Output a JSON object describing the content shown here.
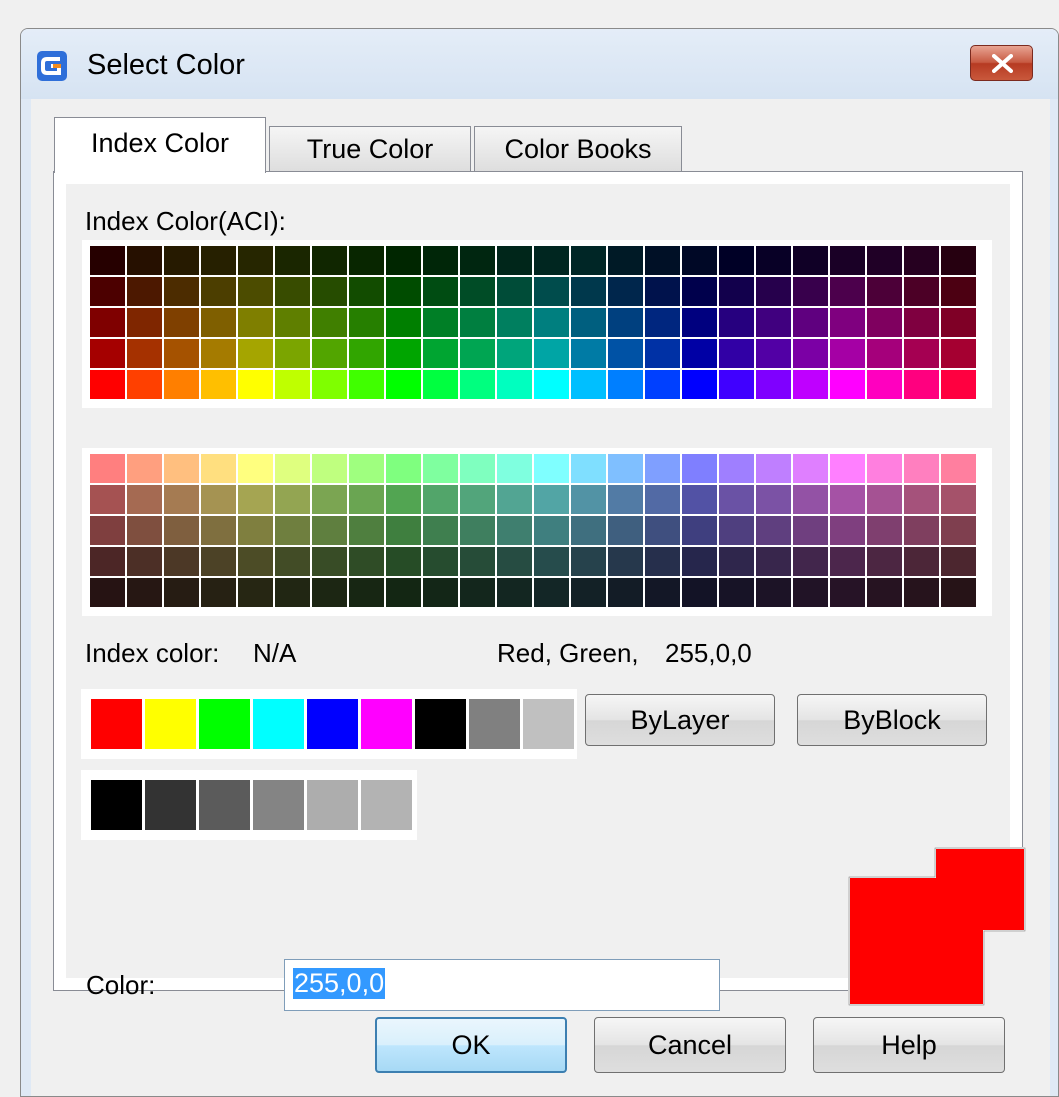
{
  "window": {
    "title": "Select Color",
    "icon": "gstarcad-logo-icon",
    "close_icon": "close-icon"
  },
  "tabs": [
    {
      "label": "Index Color",
      "active": true
    },
    {
      "label": "True Color",
      "active": false
    },
    {
      "label": "Color Books",
      "active": false
    }
  ],
  "palette": {
    "label": "Index Color(ACI):",
    "top_rows": [
      [
        "#260000",
        "#261000",
        "#261a00",
        "#262000",
        "#262600",
        "#1a2600",
        "#102600",
        "#082600",
        "#002600",
        "#002608",
        "#002610",
        "#00261a",
        "#002620",
        "#002626",
        "#001a26",
        "#001026",
        "#000826",
        "#000026",
        "#080026",
        "#100026",
        "#1a0026",
        "#200026",
        "#260020",
        "#260010"
      ],
      [
        "#4c0000",
        "#4c1800",
        "#4c2c00",
        "#4c3e00",
        "#4c4c00",
        "#384c00",
        "#264c00",
        "#124c00",
        "#004c00",
        "#004c12",
        "#004c26",
        "#004c38",
        "#004c4c",
        "#00384c",
        "#00264c",
        "#00124c",
        "#00004c",
        "#12004c",
        "#26004c",
        "#38004c",
        "#4c004c",
        "#4c0038",
        "#4c0026",
        "#4c0012"
      ],
      [
        "#7f0000",
        "#7f2600",
        "#7f4000",
        "#7f5f00",
        "#7f7f00",
        "#5f7f00",
        "#407f00",
        "#267f00",
        "#007f00",
        "#007f26",
        "#007f40",
        "#007f5f",
        "#007f7f",
        "#005f7f",
        "#00407f",
        "#00267f",
        "#00007f",
        "#26007f",
        "#40007f",
        "#5f007f",
        "#7f007f",
        "#7f005f",
        "#7f0040",
        "#7f0026"
      ],
      [
        "#a50000",
        "#a53100",
        "#a55200",
        "#a57b00",
        "#a5a500",
        "#7ba500",
        "#52a500",
        "#31a500",
        "#00a500",
        "#00a531",
        "#00a552",
        "#00a57b",
        "#00a5a5",
        "#007ba5",
        "#0052a5",
        "#0031a5",
        "#0000a5",
        "#3100a5",
        "#5200a5",
        "#7b00a5",
        "#a500a5",
        "#a5007b",
        "#a50052",
        "#a50031"
      ],
      [
        "#ff0000",
        "#ff4000",
        "#ff7f00",
        "#ffbf00",
        "#ffff00",
        "#bfff00",
        "#7fff00",
        "#40ff00",
        "#00ff00",
        "#00ff40",
        "#00ff7f",
        "#00ffbf",
        "#00ffff",
        "#00bfff",
        "#007fff",
        "#0040ff",
        "#0000ff",
        "#4000ff",
        "#7f00ff",
        "#bf00ff",
        "#ff00ff",
        "#ff00bf",
        "#ff007f",
        "#ff0040"
      ]
    ],
    "bottom_rows": [
      [
        "#ff7f7f",
        "#ff9f7f",
        "#ffbf7f",
        "#ffdf7f",
        "#ffff7f",
        "#dfff7f",
        "#bfff7f",
        "#9fff7f",
        "#7fff7f",
        "#7fff9f",
        "#7fffbf",
        "#7fffdf",
        "#7fffff",
        "#7fdfff",
        "#7fbfff",
        "#7f9fff",
        "#7f7fff",
        "#9f7fff",
        "#bf7fff",
        "#df7fff",
        "#ff7fff",
        "#ff7fdf",
        "#ff7fbf",
        "#ff7f9f"
      ],
      [
        "#a55252",
        "#a56a52",
        "#a57b52",
        "#a59352",
        "#a5a552",
        "#93a552",
        "#7ba552",
        "#6aa552",
        "#52a552",
        "#52a56a",
        "#52a57b",
        "#52a593",
        "#52a5a5",
        "#5293a5",
        "#527ba5",
        "#526aa5",
        "#5252a5",
        "#6a52a5",
        "#7b52a5",
        "#9352a5",
        "#a552a5",
        "#a55293",
        "#a5527b",
        "#a5526a"
      ],
      [
        "#7f3f3f",
        "#7f4f3f",
        "#7f5f3f",
        "#7f6f3f",
        "#7f7f3f",
        "#6f7f3f",
        "#5f7f3f",
        "#4f7f3f",
        "#3f7f3f",
        "#3f7f4f",
        "#3f7f5f",
        "#3f7f6f",
        "#3f7f7f",
        "#3f6f7f",
        "#3f5f7f",
        "#3f4f7f",
        "#3f3f7f",
        "#4f3f7f",
        "#5f3f7f",
        "#6f3f7f",
        "#7f3f7f",
        "#7f3f6f",
        "#7f3f5f",
        "#7f3f4f"
      ],
      [
        "#4c2626",
        "#4c2f26",
        "#4c3826",
        "#4c4226",
        "#4c4c26",
        "#424c26",
        "#384c26",
        "#2f4c26",
        "#264c26",
        "#264c2f",
        "#264c38",
        "#264c42",
        "#264c4c",
        "#26424c",
        "#26384c",
        "#262f4c",
        "#26264c",
        "#2f264c",
        "#38264c",
        "#42264c",
        "#4c264c",
        "#4c2642",
        "#4c2638",
        "#4c262f"
      ],
      [
        "#261313",
        "#261713",
        "#261c13",
        "#262113",
        "#262613",
        "#212613",
        "#1c2613",
        "#172613",
        "#132613",
        "#132617",
        "#13261c",
        "#132621",
        "#132626",
        "#132126",
        "#131c26",
        "#131726",
        "#131326",
        "#171326",
        "#1c1326",
        "#211326",
        "#261326",
        "#261321",
        "#26131c",
        "#261317"
      ]
    ]
  },
  "info": {
    "index_label": "Index color:",
    "index_value": "N/A",
    "rgb_label": "Red, Green,",
    "rgb_value": "255,0,0"
  },
  "standard_colors": [
    "#ff0000",
    "#ffff00",
    "#00ff00",
    "#00ffff",
    "#0000ff",
    "#ff00ff",
    "#000000",
    "#808080",
    "#c0c0c0"
  ],
  "gray_colors": [
    "#000000",
    "#333333",
    "#5b5b5b",
    "#848484",
    "#adadad",
    "#b3b3b3"
  ],
  "buttons": {
    "bylayer": "ByLayer",
    "byblock": "ByBlock",
    "ok": "OK",
    "cancel": "Cancel",
    "help": "Help"
  },
  "color_field": {
    "label": "Color:",
    "value": "255,0,0"
  },
  "preview": {
    "new_color": "#ff0000",
    "old_color": "#ff0000"
  }
}
